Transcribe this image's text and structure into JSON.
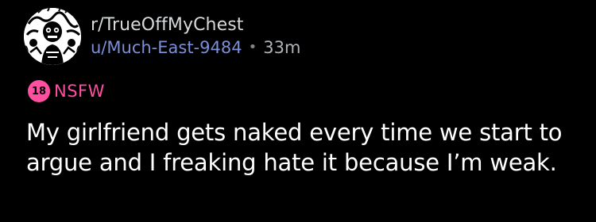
{
  "post": {
    "subreddit": "r/TrueOffMyChest",
    "username": "u/Much-East-9484",
    "separator": "•",
    "time_ago": "33m",
    "nsfw_badge": "18",
    "nsfw_label": "NSFW",
    "title": "My girlfriend gets naked every time we start to argue and I freaking hate it because I’m weak."
  },
  "icons": {
    "avatar": "subreddit-avatar",
    "nsfw": "nsfw-18-icon"
  },
  "colors": {
    "background": "#000000",
    "username": "#7c8fd6",
    "nsfw": "#ff4fa1",
    "title": "#ffffff"
  }
}
